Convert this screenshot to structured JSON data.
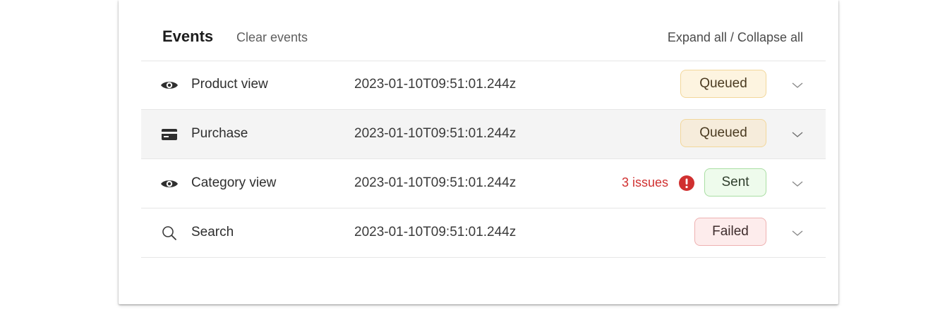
{
  "header": {
    "title": "Events",
    "clear_label": "Clear events",
    "expand_collapse_label": "Expand all / Collapse all"
  },
  "events": [
    {
      "icon": "eye-icon",
      "name": "Product view",
      "timestamp": "2023-01-10T09:51:01.244z",
      "status": "Queued"
    },
    {
      "icon": "credit-card-icon",
      "name": "Purchase",
      "timestamp": "2023-01-10T09:51:01.244z",
      "status": "Queued"
    },
    {
      "icon": "eye-icon",
      "name": "Category view",
      "timestamp": "2023-01-10T09:51:01.244z",
      "status": "Sent",
      "issues": "3 issues"
    },
    {
      "icon": "search-icon",
      "name": "Search",
      "timestamp": "2023-01-10T09:51:01.244z",
      "status": "Failed"
    }
  ],
  "colors": {
    "queued_bg": "#fdf4e0",
    "queued_border": "#f2d79b",
    "sent_bg": "#eefbec",
    "sent_border": "#a9dea3",
    "failed_bg": "#fdecec",
    "failed_border": "#eeb1b1",
    "issue": "#d03030"
  }
}
